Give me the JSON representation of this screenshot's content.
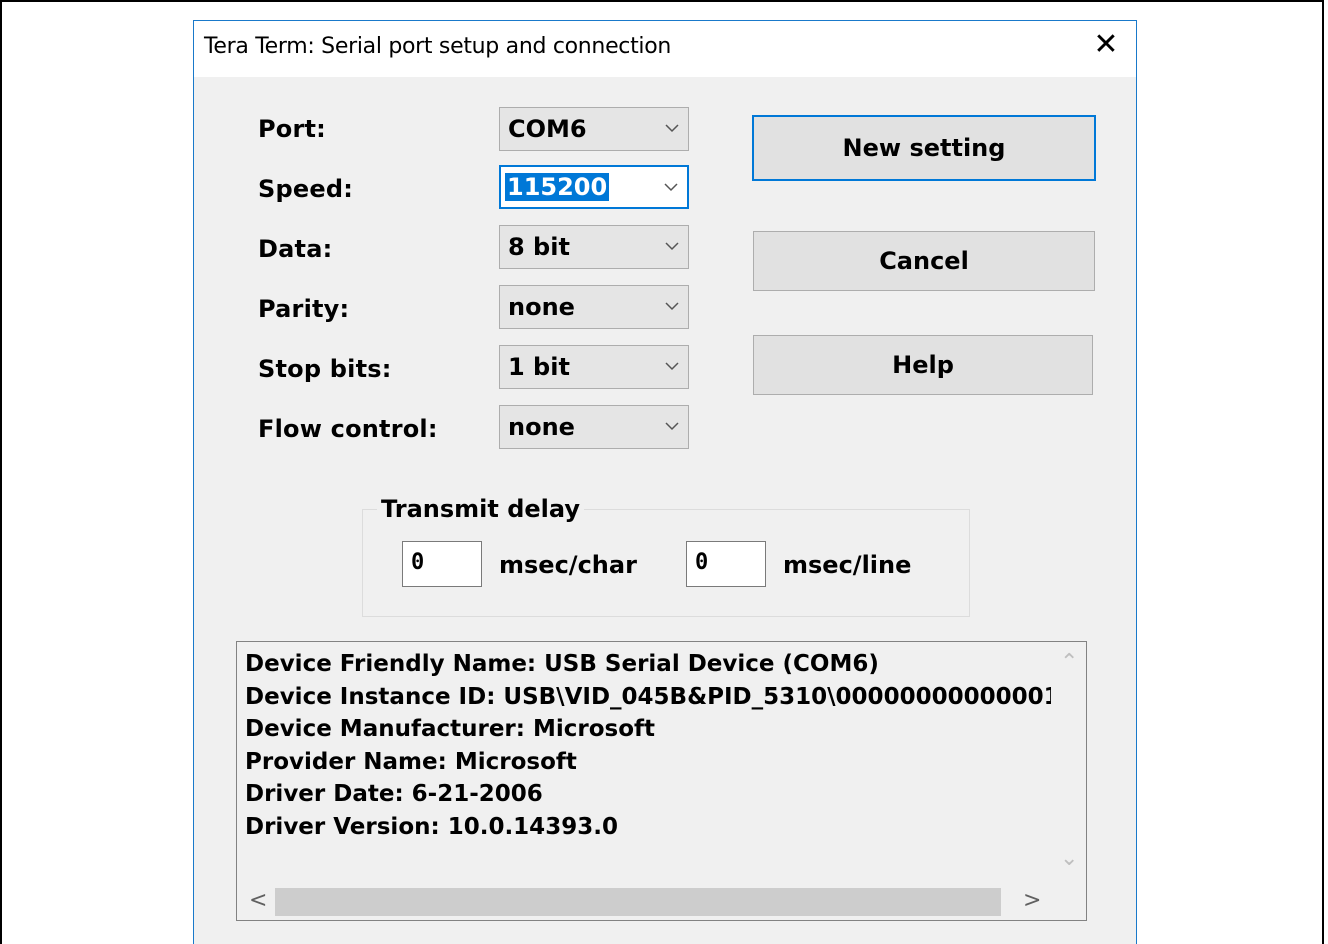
{
  "window": {
    "title": "Tera Term: Serial port setup and connection",
    "close_glyph": "✕"
  },
  "fields": [
    {
      "label": "Port:",
      "value": "COM6"
    },
    {
      "label": "Speed:",
      "value": "115200"
    },
    {
      "label": "Data:",
      "value": "8 bit"
    },
    {
      "label": "Parity:",
      "value": "none"
    },
    {
      "label": "Stop bits:",
      "value": "1 bit"
    },
    {
      "label": "Flow control:",
      "value": "none"
    }
  ],
  "buttons": {
    "new_setting": "New setting",
    "cancel": "Cancel",
    "help": "Help"
  },
  "transmit_delay": {
    "title": "Transmit delay",
    "char_value": "0",
    "char_unit": "msec/char",
    "line_value": "0",
    "line_unit": "msec/line"
  },
  "device_info": [
    "Device Friendly Name: USB Serial Device (COM6)",
    "Device Instance ID: USB\\VID_045B&PID_5310\\00000000000001",
    "Device Manufacturer: Microsoft",
    "Provider Name: Microsoft",
    "Driver Date: 6-21-2006",
    "Driver Version: 10.0.14393.0"
  ],
  "icons": {
    "dropdown": "chevron-down-icon",
    "scroll_up": "⌃",
    "scroll_down": "⌄",
    "scroll_left": "<",
    "scroll_right": ">"
  },
  "colors": {
    "accent": "#0078d7",
    "dialog_bg": "#f0f0f0",
    "button_bg": "#e1e1e1"
  }
}
